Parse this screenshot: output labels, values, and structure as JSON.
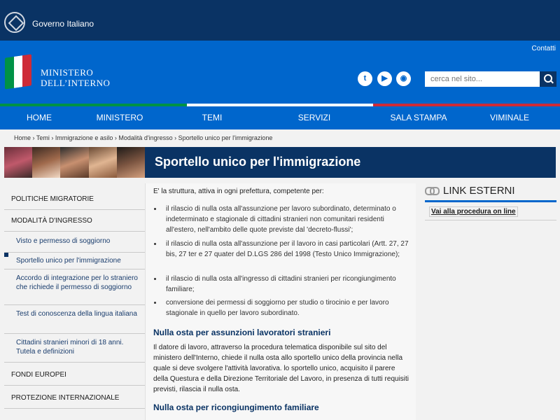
{
  "gov": {
    "title": "Governo Italiano"
  },
  "header": {
    "contacts": "Contatti",
    "ministry_line1": "MINISTERO",
    "ministry_line2": "DELL’INTERNO",
    "search_placeholder": "cerca nel sito..."
  },
  "nav": [
    "HOME",
    "MINISTERO",
    "TEMI",
    "SERVIZI",
    "SALA STAMPA",
    "VIMINALE"
  ],
  "breadcrumb": "Home › Temi › Immigrazione e asilo › Modalità d'ingresso › Sportello unico per l'immigrazione",
  "page_title": "Sportello unico per l'immigrazione",
  "sidebar": [
    {
      "label": "POLITICHE MIGRATORIE",
      "level": "top"
    },
    {
      "label": "MODALITÀ D'INGRESSO",
      "level": "top"
    },
    {
      "label": "Visto e permesso di soggiorno",
      "level": "sub"
    },
    {
      "label": "Sportello unico per l'immigrazione",
      "level": "sub",
      "active": true
    },
    {
      "label": "Accordo di integrazione per lo straniero che richiede il permesso di soggiorno",
      "level": "sub"
    },
    {
      "label": "Test di conoscenza della lingua italiana",
      "level": "sub"
    },
    {
      "label": "Cittadini stranieri minori di 18 anni. Tutela e definizioni",
      "level": "sub"
    },
    {
      "label": "FONDI EUROPEI",
      "level": "top"
    },
    {
      "label": "PROTEZIONE INTERNAZIONALE",
      "level": "top"
    }
  ],
  "main": {
    "intro": "E' la struttura, attiva in ogni prefettura, competente per:",
    "bullets": [
      "il rilascio di nulla osta all'assunzione per lavoro subordinato, determinato o indeterminato e stagionale di cittadini stranieri non comunitari residenti all'estero, nell'ambito delle quote previste dal 'decreto-flussi';",
      "il rilascio di nulla osta all'assunzione per il lavoro in casi particolari (Artt. 27, 27 bis, 27 ter e 27 quater del D.LGS 286 del 1998 (Testo Unico Immigrazione);",
      "il rilascio di nulla osta all'ingresso di cittadini stranieri per ricongiungimento familiare;",
      "conversione dei permessi di soggiorno per studio o tirocinio e per lavoro stagionale  in quello per lavoro subordinato."
    ],
    "heading1": "Nulla osta per assunzioni lavoratori stranieri",
    "para1": "Il datore di lavoro, attraverso la procedura telematica disponibile sul sito del ministero dell'Interno, chiede il nulla osta allo sportello unico della provincia nella quale si deve svolgere l'attività lavorativa. lo sportello unico, acquisito il parere della Questura e della Direzione Territoriale del Lavoro, in presenza di tutti requisiti previsti, rilascia il nulla osta.",
    "heading2": "Nulla osta per ricongiungimento familiare"
  },
  "right": {
    "title": "LINK ESTERNI",
    "link": "Vai alla procedura on line"
  },
  "colors": {
    "navy": "#0a3364",
    "blue": "#0066cc",
    "green": "#009246",
    "red": "#ce2b37"
  },
  "icons": [
    "emblem-icon",
    "twitter-icon",
    "youtube-icon",
    "rss-icon",
    "search-icon",
    "link-icon"
  ]
}
